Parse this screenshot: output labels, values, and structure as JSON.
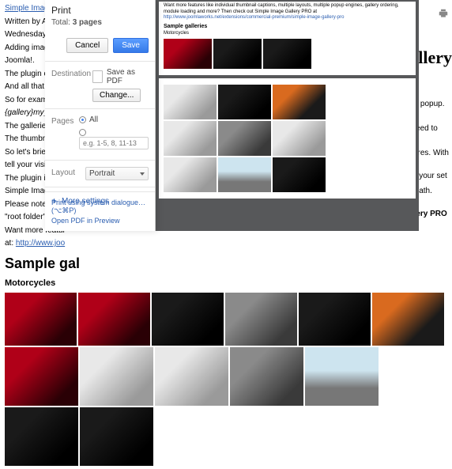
{
  "article": {
    "title_link": "Simple Image Ga",
    "byline": "Written by Admi",
    "date": "Wednesday, 27 Ja",
    "p1": "Adding image ga",
    "p1b": "Joomla!.",
    "p2": "The plugin can tu",
    "p2b": "And all that using",
    "p3": "So for example, i",
    "p3b": "{gallery}my_trip",
    "p4": "The galleries crea",
    "p4b": "The thumbnails a",
    "p5": "So let's briefly se",
    "p5b": "tell your visitors t",
    "p6": "The plugin is ide",
    "p6b": "Simple Image Ga",
    "p7": "Please note that y",
    "p7b": "\"root folder\"), e.g",
    "p8": "Want more featur",
    "p8link": "http://www.joo",
    "h_samples": "Sample gal",
    "h_moto": "Motorcycles",
    "bigword": "allery",
    "right1": "hbox popup.",
    "right2": "n't need to",
    "right3": "pictures. With",
    "right4": "after your set",
    "right5": "our path.",
    "right6": "Gallery PRO"
  },
  "dialog": {
    "title": "Print",
    "total_label": "Total:",
    "total_value": "3 pages",
    "cancel": "Cancel",
    "save": "Save",
    "dest_label": "Destination",
    "dest_value": "Save as PDF",
    "change": "Change...",
    "pages_label": "Pages",
    "pages_all": "All",
    "pages_placeholder": "e.g. 1-5, 8, 11-13",
    "layout_label": "Layout",
    "layout_value": "Portrait",
    "more": "More settings",
    "sys": "Print using system dialogue… (⌥⌘P)",
    "openpdf": "Open PDF in Preview"
  },
  "preview": {
    "promo": "Want more features like individual thumbnail captions, multiple layouts, multiple popup engines, gallery ordering, module loading and more? Then check out Simple Image Gallery PRO at",
    "promo_link": "http://www.joomlaworks.net/extensions/commercial-premium/simple-image-gallery-pro",
    "h_samples": "Sample galleries",
    "h_moto": "Motorcycles"
  }
}
